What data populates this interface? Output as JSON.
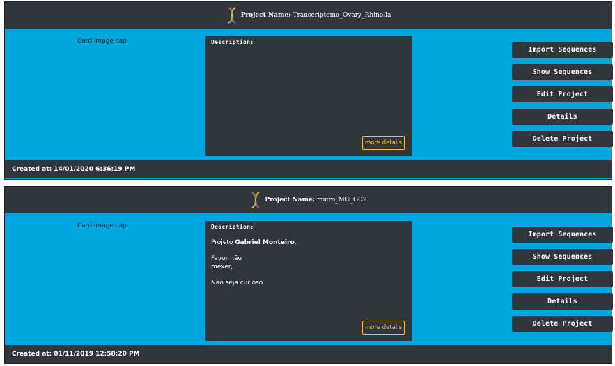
{
  "projects": [
    {
      "name_label": "Project Name:",
      "name": "Transcriptome_Ovary_Rhinella",
      "image_cap": "Card image cap",
      "description_title": "Description:",
      "description_lines": [],
      "more_details": "more details",
      "actions": [
        "Import Sequences",
        "Show Sequences",
        "Edit Project",
        "Details",
        "Delete Project"
      ],
      "created": "Created at: 14/01/2020 6:36:19 PM"
    },
    {
      "name_label": "Project Name:",
      "name": "micro_MU_GC2",
      "image_cap": "Card image cap",
      "description_title": "Description:",
      "description": {
        "line1_prefix": "Projeto ",
        "line1_bold": "Gabriel Monteiro",
        "line1_suffix": ",",
        "line2a": "Favor não",
        "line2b": "mexer,",
        "line3": "Não seja curioso"
      },
      "more_details": "more details",
      "actions": [
        "Import Sequences",
        "Show Sequences",
        "Edit Project",
        "Details",
        "Delete Project"
      ],
      "created": "Created at: 01/11/2019 12:58:20 PM"
    }
  ],
  "colors": {
    "card_bg": "#00a6df",
    "header_bg": "#31363d",
    "button_border": "#f2c12e"
  },
  "icons": {
    "project": "dna-icon"
  }
}
